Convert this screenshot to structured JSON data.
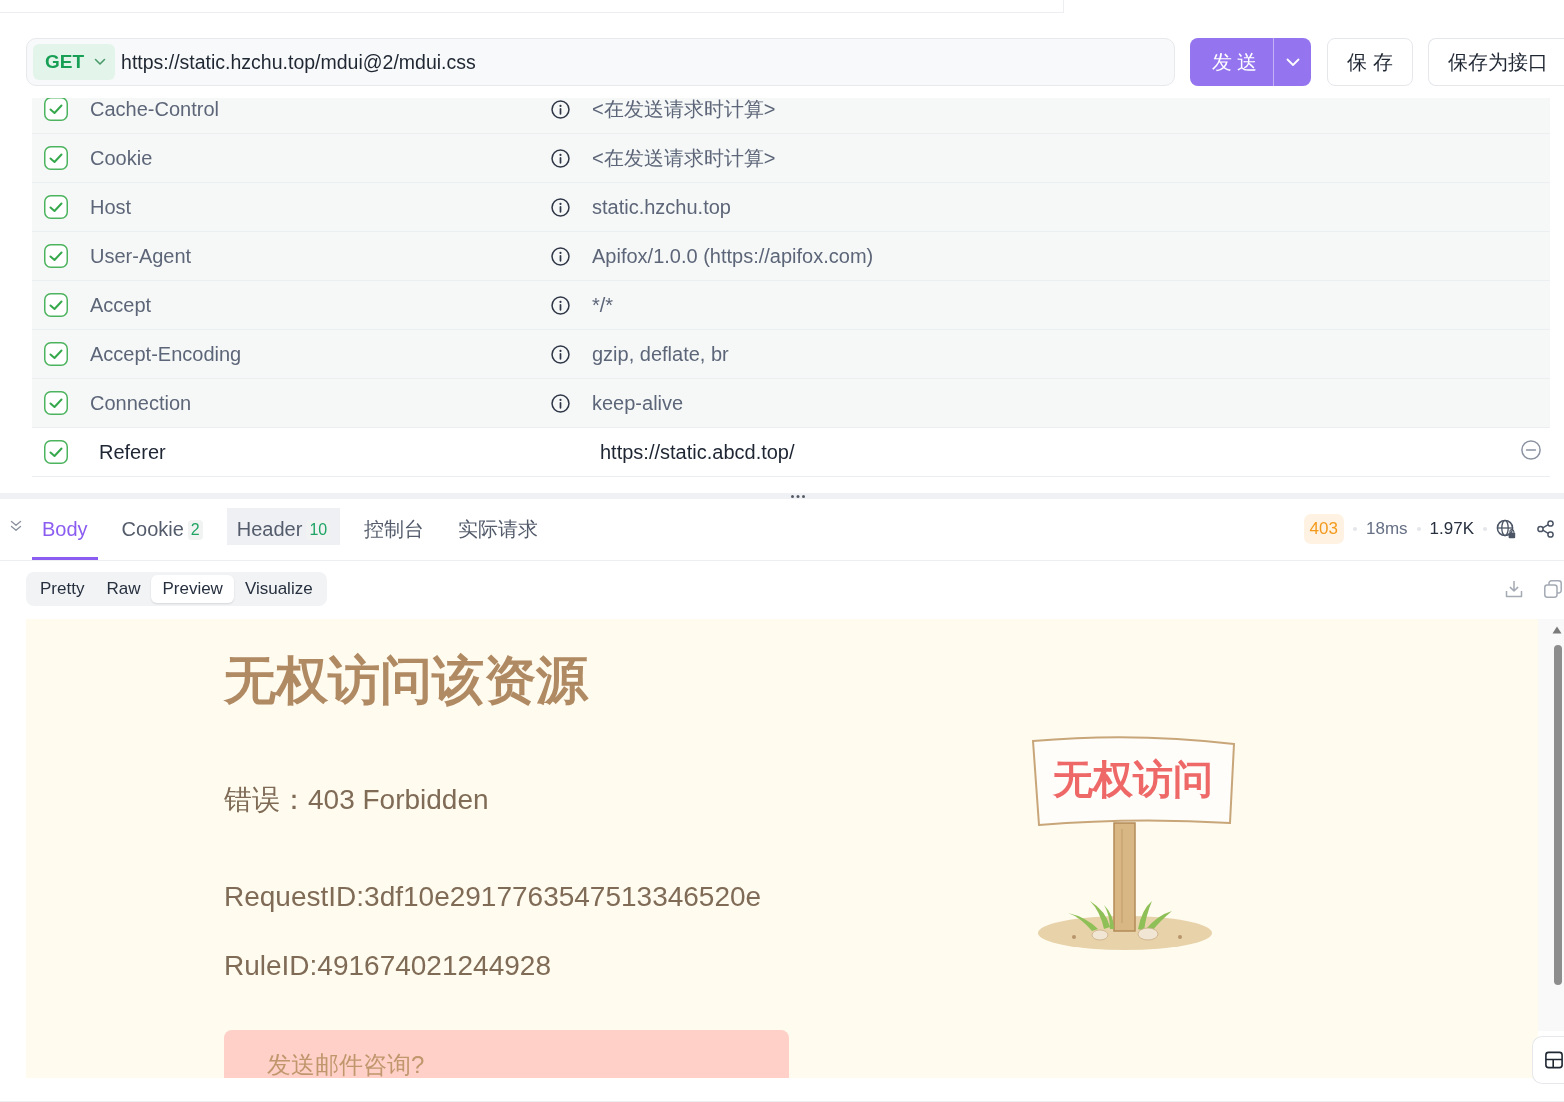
{
  "request": {
    "method": "GET",
    "url": "https://static.hzchu.top/mdui@2/mdui.css",
    "send_label": "发 送",
    "save_label": "保 存",
    "save_as_label": "保存为接口"
  },
  "headers": [
    {
      "kind": "auto",
      "checked": true,
      "key": "Cache-Control",
      "value": "<在发送请求时计算>"
    },
    {
      "kind": "auto",
      "checked": true,
      "key": "Cookie",
      "value": "<在发送请求时计算>"
    },
    {
      "kind": "auto",
      "checked": true,
      "key": "Host",
      "value": "static.hzchu.top"
    },
    {
      "kind": "auto",
      "checked": true,
      "key": "User-Agent",
      "value": "Apifox/1.0.0 (https://apifox.com)"
    },
    {
      "kind": "auto",
      "checked": true,
      "key": "Accept",
      "value": "*/*"
    },
    {
      "kind": "auto",
      "checked": true,
      "key": "Accept-Encoding",
      "value": "gzip, deflate, br"
    },
    {
      "kind": "auto",
      "checked": true,
      "key": "Connection",
      "value": "keep-alive"
    },
    {
      "kind": "custom",
      "checked": true,
      "key": "Referer",
      "value": "https://static.abcd.top/"
    }
  ],
  "response": {
    "tabs": [
      {
        "label": "Body",
        "selected": true,
        "hovered": false
      },
      {
        "label": "Cookie",
        "badge": "2",
        "selected": false,
        "hovered": false
      },
      {
        "label": "Header",
        "badge": "10",
        "selected": false,
        "hovered": true
      },
      {
        "label": "控制台",
        "selected": false,
        "hovered": false
      },
      {
        "label": "实际请求",
        "selected": false,
        "hovered": false
      }
    ],
    "status": {
      "code": "403",
      "time": "18ms",
      "size": "1.97K"
    },
    "view_modes": [
      {
        "label": "Pretty",
        "selected": false
      },
      {
        "label": "Raw",
        "selected": false
      },
      {
        "label": "Preview",
        "selected": true
      },
      {
        "label": "Visualize",
        "selected": false
      }
    ],
    "preview": {
      "title": "无权访问该资源",
      "error": "错误：403 Forbidden",
      "request_id": "RequestID:3df10e2917763547513346520e",
      "rule_id": "RuleID:491674021244928",
      "sign_text": "无权访问",
      "contact_button": "发送邮件咨询?"
    }
  }
}
